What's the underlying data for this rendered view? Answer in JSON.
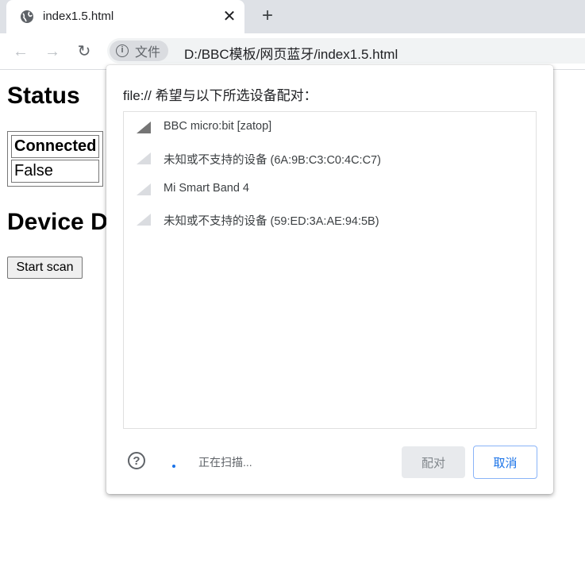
{
  "browser": {
    "tab": {
      "title": "index1.5.html",
      "favicon": "globe-icon",
      "close_glyph": "✕"
    },
    "new_tab_glyph": "+",
    "toolbar": {
      "back_glyph": "←",
      "forward_glyph": "→",
      "reload_glyph": "↻",
      "site_chip_label": "文件",
      "url": "D:/BBC模板/网页蓝牙/index1.5.html"
    }
  },
  "page": {
    "status_heading": "Status",
    "status_table": {
      "header": "Connected",
      "value": "False"
    },
    "device_heading": "Device Details",
    "scan_button": "Start scan"
  },
  "dialog": {
    "title": "file:// 希望与以下所选设备配对：",
    "devices": [
      {
        "name": "BBC micro:bit [zatop]",
        "signal": "strong"
      },
      {
        "name": "未知或不支持的设备 (6A:9B:C3:C0:4C:C7)",
        "signal": "weak"
      },
      {
        "name": "Mi Smart Band 4",
        "signal": "weak"
      },
      {
        "name": "未知或不支持的设备 (59:ED:3A:AE:94:5B)",
        "signal": "weak"
      }
    ],
    "help_glyph": "?",
    "scan_status": "正在扫描...",
    "pair_button": "配对",
    "cancel_button": "取消"
  },
  "colors": {
    "accent": "#1a73e8",
    "signal_strong": "#757575",
    "signal_weak": "#dadce0"
  }
}
